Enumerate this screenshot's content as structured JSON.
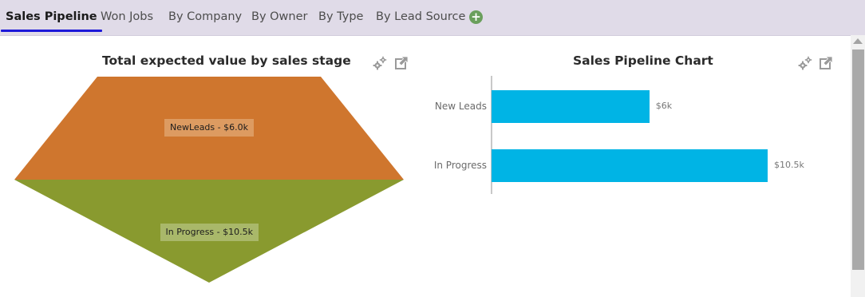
{
  "tabs": [
    {
      "label": "Sales Pipeline",
      "active": true
    },
    {
      "label": "Won Jobs",
      "active": false
    },
    {
      "label": "By Company",
      "active": false
    },
    {
      "label": "By Owner",
      "active": false
    },
    {
      "label": "By Type",
      "active": false
    },
    {
      "label": "By Lead Source",
      "active": false
    }
  ],
  "add_tab_symbol": "+",
  "funnel_widget": {
    "title": "Total expected value by sales stage",
    "icons": [
      "gear-icon",
      "popout-icon"
    ],
    "chart_data": {
      "type": "funnel",
      "stages": [
        {
          "name": "NewLeads",
          "value": 6.0,
          "label": "NewLeads - $6.0k",
          "color": "#cf762e"
        },
        {
          "name": "In Progress",
          "value": 10.5,
          "label": "In Progress - $10.5k",
          "color": "#899a2f"
        }
      ]
    }
  },
  "bar_widget": {
    "title": "Sales Pipeline Chart",
    "icons": [
      "gear-icon",
      "popout-icon"
    ],
    "chart_data": {
      "type": "bar",
      "orientation": "horizontal",
      "categories": [
        "New Leads",
        "In Progress"
      ],
      "values": [
        6,
        10.5
      ],
      "value_labels": [
        "$6k",
        "$10.5k"
      ],
      "color": "#00b4e5",
      "xlim": [
        0,
        11
      ]
    }
  }
}
